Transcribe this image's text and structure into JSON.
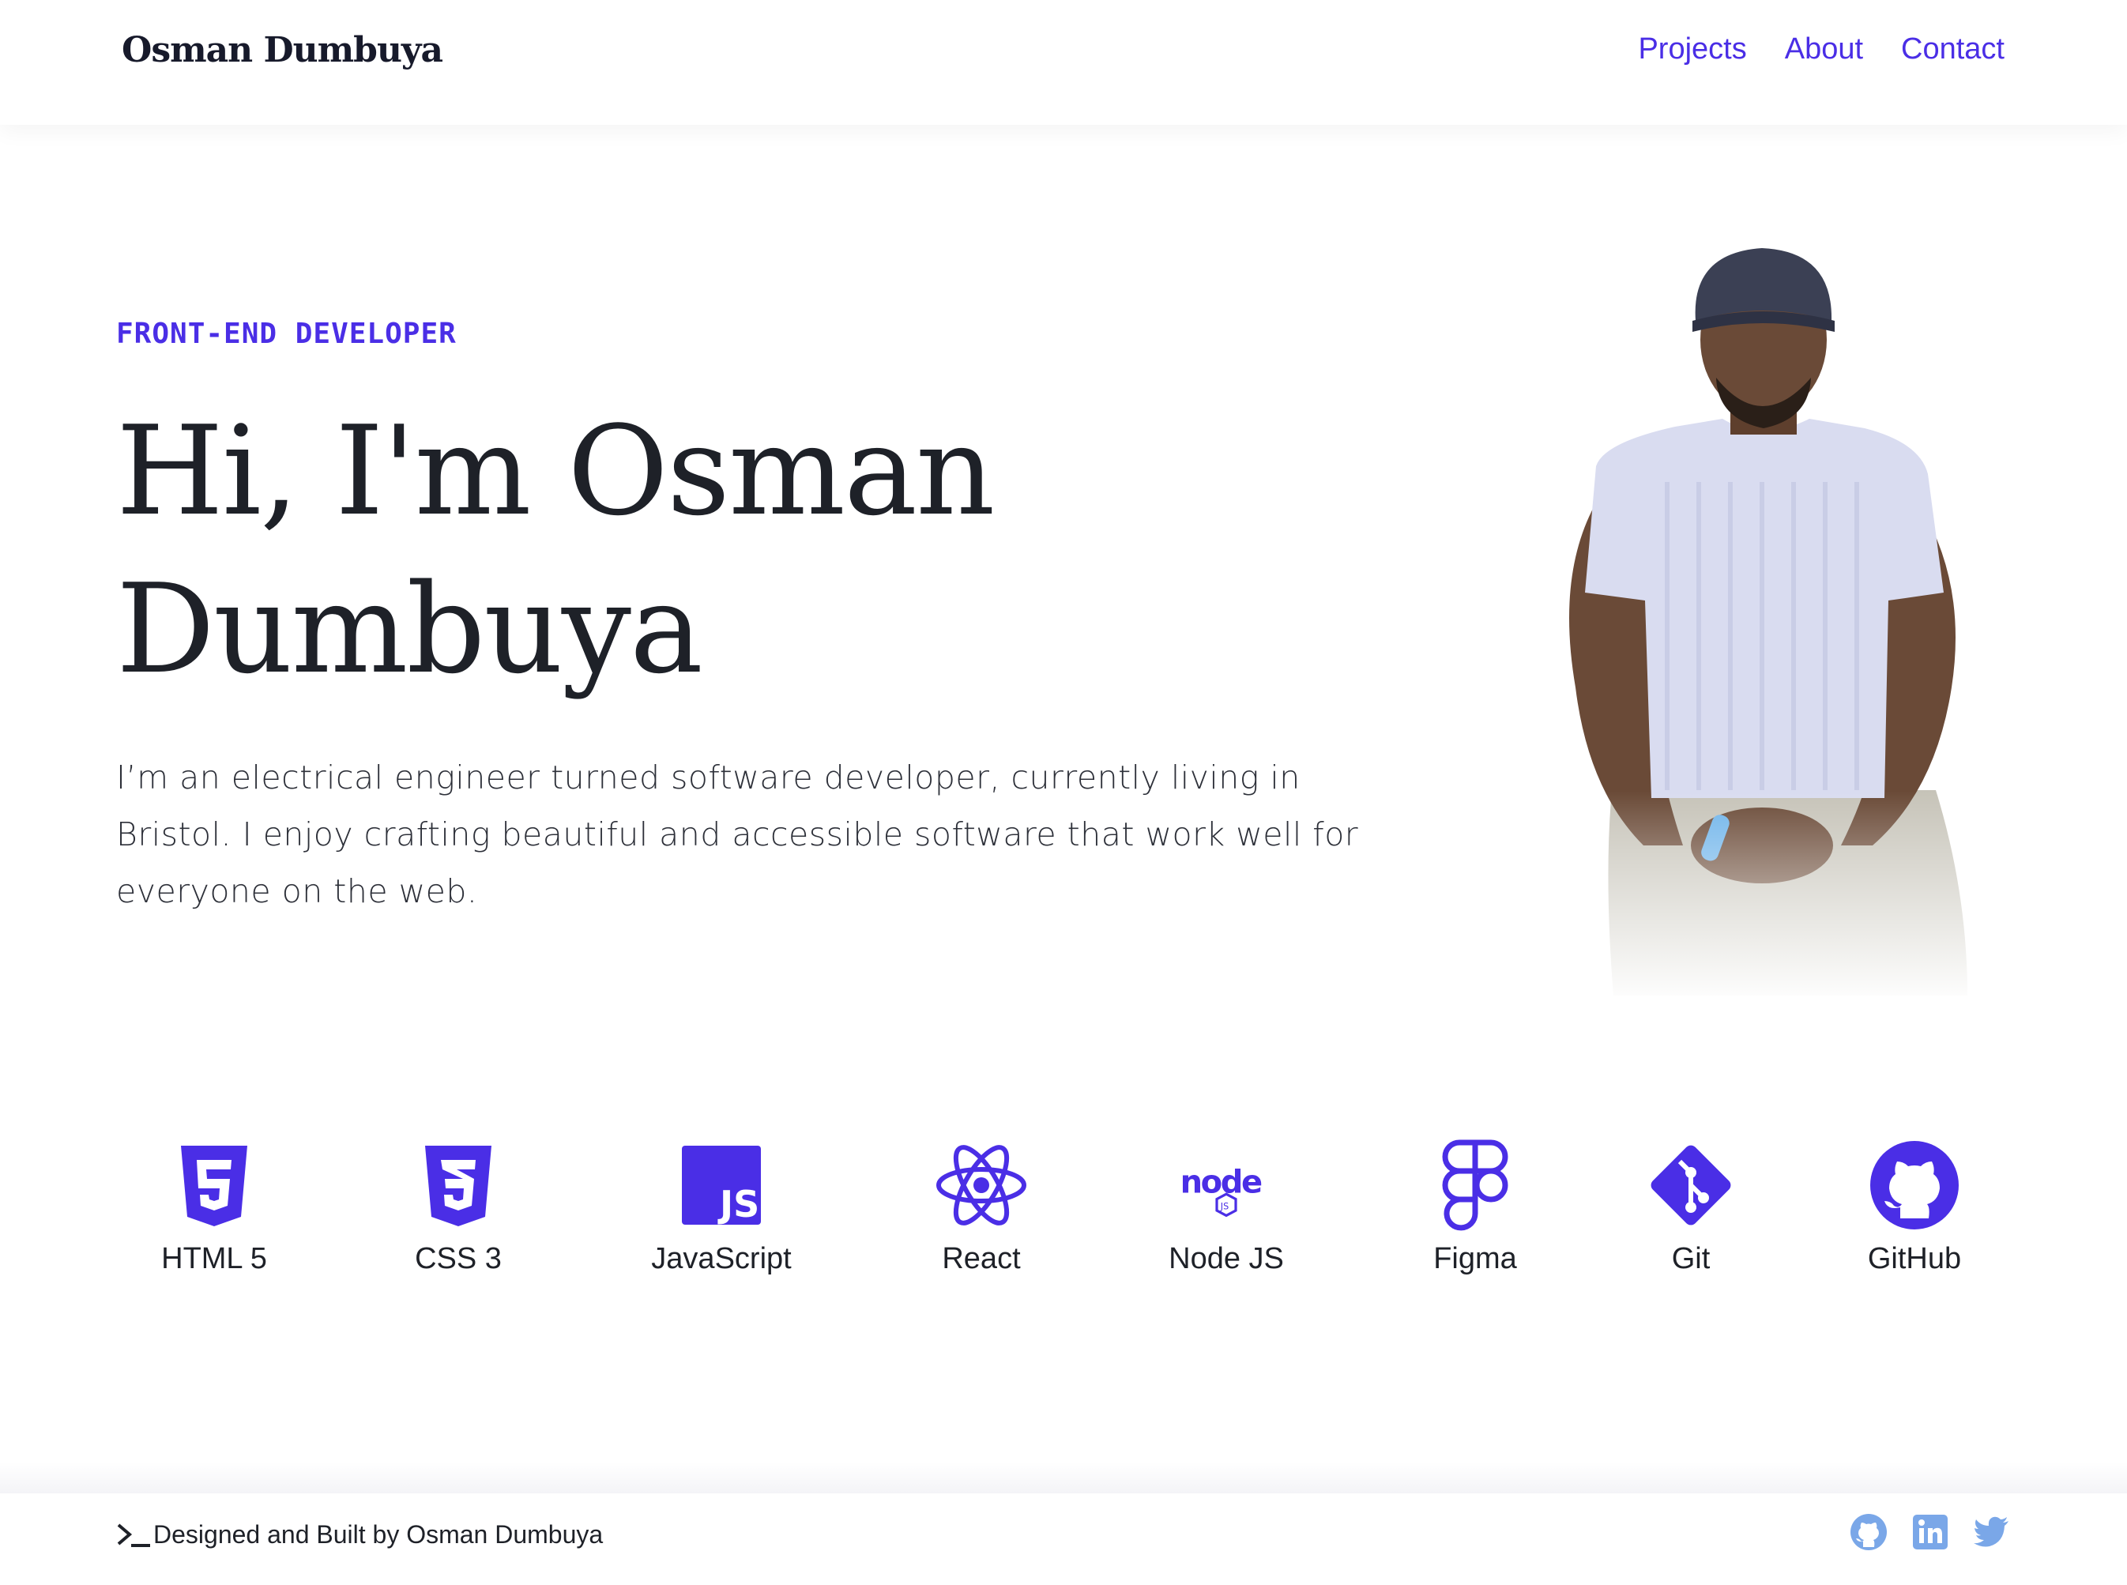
{
  "header": {
    "logo": "Osman Dumbuya",
    "nav": [
      {
        "label": "Projects"
      },
      {
        "label": "About"
      },
      {
        "label": "Contact"
      }
    ]
  },
  "hero": {
    "eyebrow": "FRONT-END DEVELOPER",
    "title_line1": "Hi, I'm Osman",
    "title_line2": "Dumbuya",
    "intro": "I’m an electrical engineer turned software developer, currently living in Bristol. I enjoy crafting beautiful and accessible software that work well for everyone on the web."
  },
  "skills": [
    {
      "label": "HTML 5",
      "icon": "html5-icon"
    },
    {
      "label": "CSS 3",
      "icon": "css3-icon"
    },
    {
      "label": "JavaScript",
      "icon": "javascript-icon"
    },
    {
      "label": "React",
      "icon": "react-icon"
    },
    {
      "label": "Node JS",
      "icon": "nodejs-icon"
    },
    {
      "label": "Figma",
      "icon": "figma-icon"
    },
    {
      "label": "Git",
      "icon": "git-icon"
    },
    {
      "label": "GitHub",
      "icon": "github-icon"
    }
  ],
  "footer": {
    "credit": "Designed and Built by Osman Dumbuya",
    "socials": [
      "github-icon",
      "linkedin-icon",
      "twitter-icon"
    ]
  },
  "colors": {
    "accent": "#4a2ee6",
    "text": "#1e2128",
    "social": "#7aa7e8"
  }
}
